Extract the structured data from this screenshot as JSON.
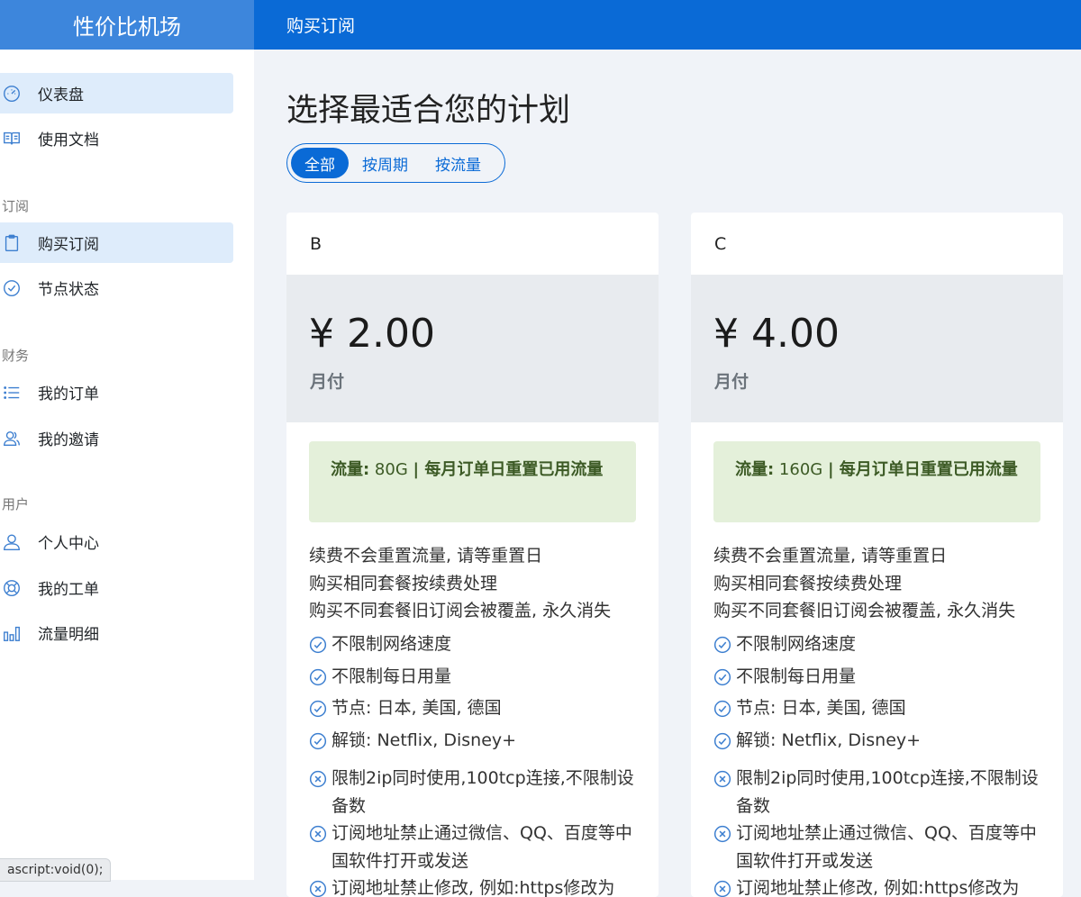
{
  "brand": "性价比机场",
  "header_title": "购买订阅",
  "sidebar": {
    "items": [
      {
        "label": "仪表盘",
        "icon": "dashboard-gauge-icon",
        "active": true
      },
      {
        "label": "使用文档",
        "icon": "book-icon",
        "active": false
      },
      {
        "label": "购买订阅",
        "icon": "clipboard-icon",
        "active": true
      },
      {
        "label": "节点状态",
        "icon": "check-circle-icon",
        "active": false
      },
      {
        "label": "我的订单",
        "icon": "list-icon",
        "active": false
      },
      {
        "label": "我的邀请",
        "icon": "users-icon",
        "active": false
      },
      {
        "label": "个人中心",
        "icon": "user-icon",
        "active": false
      },
      {
        "label": "我的工单",
        "icon": "lifebuoy-icon",
        "active": false
      },
      {
        "label": "流量明细",
        "icon": "bar-chart-icon",
        "active": false
      }
    ],
    "sections": [
      "订阅",
      "财务",
      "用户"
    ]
  },
  "status_text": "ascript:void(0);",
  "main": {
    "title": "选择最适合您的计划",
    "tabs": [
      {
        "label": "全部",
        "active": true
      },
      {
        "label": "按周期",
        "active": false
      },
      {
        "label": "按流量",
        "active": false
      }
    ],
    "plans": [
      {
        "name": "B",
        "price": "¥ 2.00",
        "period": "月付",
        "traffic_prefix": "流量:",
        "traffic_amount": " 80G ",
        "traffic_suffix": "| 每月订单日重置已用流量",
        "notes": [
          "续费不会重置流量, 请等重置日",
          "购买相同套餐按续费处理",
          "购买不同套餐旧订阅会被覆盖, 永久消失"
        ],
        "features_ok": [
          "不限制网络速度",
          "不限制每日用量",
          "节点: 日本, 美国, 德国",
          "解锁: Netflix, Disney+"
        ],
        "features_no": [
          "限制2ip同时使用,100tcp连接,不限制设备数",
          "订阅地址禁止通过微信、QQ、百度等中国软件打开或发送",
          "订阅地址禁止修改, 例如:https修改为"
        ]
      },
      {
        "name": "C",
        "price": "¥ 4.00",
        "period": "月付",
        "traffic_prefix": "流量:",
        "traffic_amount": " 160G ",
        "traffic_suffix": "| 每月订单日重置已用流量",
        "notes": [
          "续费不会重置流量, 请等重置日",
          "购买相同套餐按续费处理",
          "购买不同套餐旧订阅会被覆盖, 永久消失"
        ],
        "features_ok": [
          "不限制网络速度",
          "不限制每日用量",
          "节点: 日本, 美国, 德国",
          "解锁: Netflix, Disney+"
        ],
        "features_no": [
          "限制2ip同时使用,100tcp连接,不限制设备数",
          "订阅地址禁止通过微信、QQ、百度等中国软件打开或发送",
          "订阅地址禁止修改, 例如:https修改为"
        ]
      }
    ]
  },
  "colors": {
    "primary": "#0a6ad6",
    "brand_bg": "#3d86dc",
    "active_nav": "#deecfb",
    "traffic_box": "#e4f0da"
  }
}
